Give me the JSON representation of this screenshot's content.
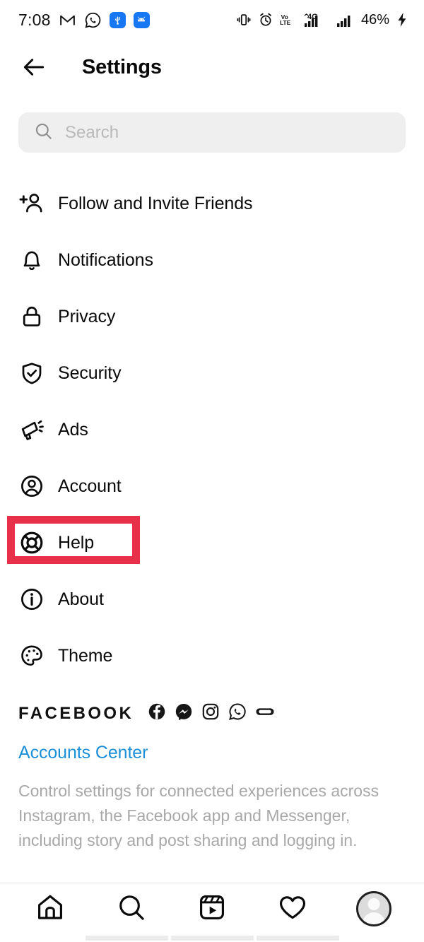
{
  "statusbar": {
    "time": "7:08",
    "left_icons": [
      "gmail-icon",
      "whatsapp-icon",
      "usb-icon",
      "android-icon"
    ],
    "right_icons": [
      "vibrate-icon",
      "alarm-icon",
      "volte-icon",
      "signal-4g-icon",
      "signal-bars-icon"
    ],
    "battery": "46%",
    "charging": true
  },
  "header": {
    "back_label": "back-arrow",
    "title": "Settings"
  },
  "search": {
    "placeholder": "Search",
    "value": ""
  },
  "menu": {
    "items": [
      {
        "label": "Follow and Invite Friends",
        "icon": "add-person-icon",
        "highlighted": false
      },
      {
        "label": "Notifications",
        "icon": "bell-icon",
        "highlighted": false
      },
      {
        "label": "Privacy",
        "icon": "lock-icon",
        "highlighted": false
      },
      {
        "label": "Security",
        "icon": "shield-check-icon",
        "highlighted": false
      },
      {
        "label": "Ads",
        "icon": "megaphone-icon",
        "highlighted": false
      },
      {
        "label": "Account",
        "icon": "person-circle-icon",
        "highlighted": false
      },
      {
        "label": "Help",
        "icon": "lifebuoy-icon",
        "highlighted": true
      },
      {
        "label": "About",
        "icon": "info-circle-icon",
        "highlighted": false
      },
      {
        "label": "Theme",
        "icon": "palette-icon",
        "highlighted": false
      }
    ]
  },
  "facebook": {
    "heading": "FACEBOOK",
    "brand_icons": [
      "facebook-icon",
      "messenger-icon",
      "instagram-icon",
      "whatsapp-icon",
      "oculus-icon"
    ],
    "link": "Accounts Center",
    "description": "Control settings for connected experiences across Instagram, the Facebook app and Messenger, including story and post sharing and logging in."
  },
  "bottomnav": {
    "items": [
      {
        "name": "home",
        "icon": "home-icon"
      },
      {
        "name": "search",
        "icon": "search-icon"
      },
      {
        "name": "reels",
        "icon": "reels-icon"
      },
      {
        "name": "activity",
        "icon": "heart-icon"
      },
      {
        "name": "profile",
        "icon": "avatar-icon"
      }
    ]
  },
  "colors": {
    "highlight_red": "#E8304A",
    "link_blue": "#1C8FD8",
    "search_bg": "#EFEFEF",
    "muted_text": "#A8A8A8"
  }
}
